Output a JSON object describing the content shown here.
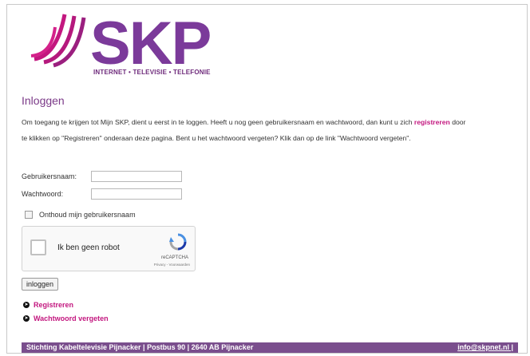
{
  "brand": {
    "logo_text": "SKP",
    "tagline": "INTERNET • TELEVISIE • TELEFONIE",
    "colors": {
      "purple": "#6e2a7b",
      "magenta": "#c3177f",
      "footer": "#7a4e8d"
    }
  },
  "page": {
    "title": "Inloggen",
    "intro_before": "Om toegang te krijgen tot Mijn SKP, dient u eerst in te loggen. Heeft u nog geen gebruikersnaam en wachtwoord, dan kunt u zich",
    "intro_link": "registreren",
    "intro_after": "door te klikken op \"Registreren\" onderaan deze pagina. Bent u het wachtwoord vergeten? Klik dan op de link \"Wachtwoord vergeten\"."
  },
  "form": {
    "username_label": "Gebruikersnaam:",
    "username_value": "",
    "password_label": "Wachtwoord:",
    "password_value": "",
    "remember_label": "Onthoud mijn gebruikersnaam",
    "login_button": "inloggen"
  },
  "captcha": {
    "label": "Ik ben geen robot",
    "brand": "reCAPTCHA",
    "privacy": "Privacy - Voorwaarden"
  },
  "links": {
    "register": "Registreren",
    "forgot_password": "Wachtwoord vergeten"
  },
  "footer": {
    "address": "Stichting Kabeltelevisie Pijnacker | Postbus 90 | 2640 AB Pijnacker",
    "email": "info@skpnet.nl |"
  }
}
